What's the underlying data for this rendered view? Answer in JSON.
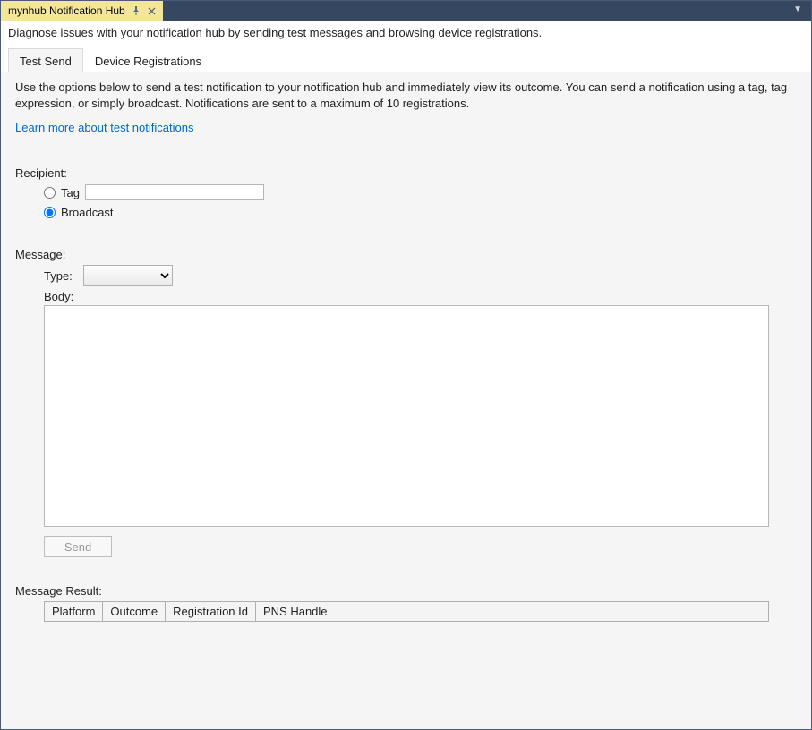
{
  "titlebar": {
    "tab_title": "mynhub Notification Hub"
  },
  "description": "Diagnose issues with your notification hub by sending test messages and browsing device registrations.",
  "tabs": {
    "test_send": "Test Send",
    "device_registrations": "Device Registrations"
  },
  "intro_text": "Use the options below to send a test notification to your notification hub and immediately view its outcome. You can send a notification using a tag, tag expression, or simply broadcast. Notifications are sent to a maximum of 10 registrations.",
  "learn_more": "Learn more about test notifications",
  "recipient": {
    "label": "Recipient:",
    "tag_label": "Tag",
    "tag_value": "",
    "broadcast_label": "Broadcast",
    "selected": "broadcast"
  },
  "message": {
    "label": "Message:",
    "type_label": "Type:",
    "type_value": "",
    "body_label": "Body:",
    "body_value": "",
    "send_label": "Send"
  },
  "result": {
    "label": "Message Result:",
    "columns": {
      "platform": "Platform",
      "outcome": "Outcome",
      "registration_id": "Registration Id",
      "pns_handle": "PNS Handle"
    }
  }
}
